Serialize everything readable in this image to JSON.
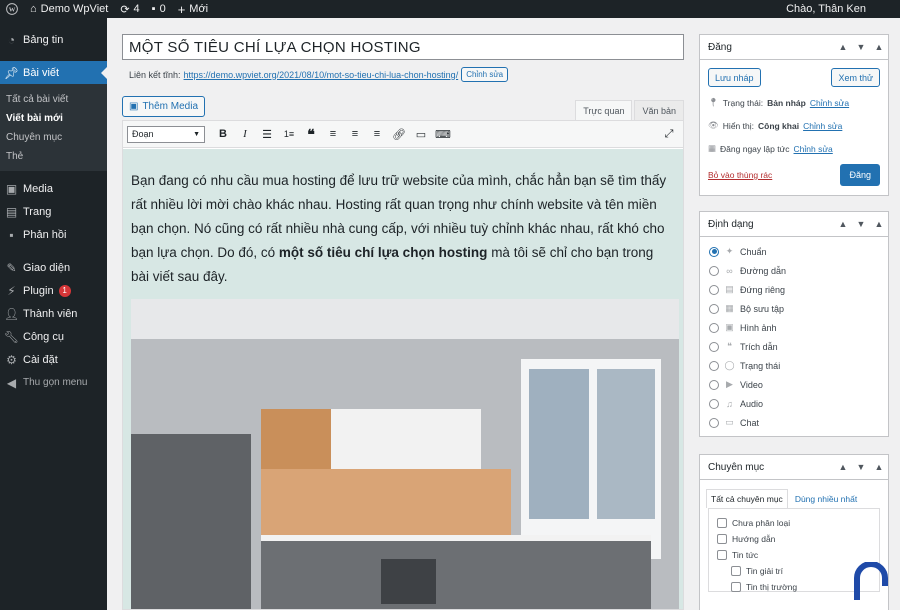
{
  "adminbar": {
    "site_name": "Demo WpViet",
    "updates_count": "4",
    "comments_count": "0",
    "new_label": "Mới",
    "greeting": "Chào, Thân Ken"
  },
  "sidebar": {
    "dashboard": "Bảng tin",
    "posts": "Bài viết",
    "posts_sub": [
      "Tất cả bài viết",
      "Viết bài mới",
      "Chuyên mục",
      "Thẻ"
    ],
    "media": "Media",
    "pages": "Trang",
    "comments": "Phản hồi",
    "appearance": "Giao diện",
    "plugins": "Plugin",
    "plugins_badge": "1",
    "users": "Thành viên",
    "tools": "Công cụ",
    "settings": "Cài đặt",
    "collapse": "Thu gọn menu"
  },
  "editor": {
    "title_value": "MỘT SỐ TIÊU CHÍ LỰA CHỌN HOSTING",
    "permalink_label": "Liên kết tĩnh:",
    "permalink_url": "https://demo.wpviet.org/2021/08/10/mot-so-tieu-chi-lua-chon-hosting/",
    "permalink_edit": "Chỉnh sửa",
    "add_media": "Thêm Media",
    "tab_visual": "Trực quan",
    "tab_text": "Văn bản",
    "format_select": "Đoạn",
    "paragraph_before": "Bạn đang có nhu cầu mua hosting để lưu trữ website của mình, chắc hẳn bạn sẽ tìm thấy rất nhiều lời mời chào khác nhau. Hosting rất quan trọng như chính website và tên miền bạn chọn. Nó cũng có rất nhiều nhà cung cấp, với nhiều tuỳ chỉnh khác nhau, rất khó cho bạn lựa chọn. Do đó, có ",
    "paragraph_bold": "một số tiêu chí lựa chọn hosting",
    "paragraph_after": " mà tôi sẽ chỉ cho bạn trong bài viết sau đây."
  },
  "publish": {
    "title": "Đăng",
    "save_draft": "Lưu nháp",
    "preview": "Xem thử",
    "status_label": "Trạng thái:",
    "status_value": "Bản nháp",
    "visibility_label": "Hiển thị:",
    "visibility_value": "Công khai",
    "schedule_value": "Đăng ngay lập tức",
    "edit_link": "Chỉnh sửa",
    "trash": "Bỏ vào thùng rác",
    "publish_button": "Đăng"
  },
  "format": {
    "title": "Định dạng",
    "options": [
      "Chuẩn",
      "Đường dẫn",
      "Đứng riêng",
      "Bộ sưu tập",
      "Hình ảnh",
      "Trích dẫn",
      "Trạng thái",
      "Video",
      "Audio",
      "Chat"
    ],
    "selected": "Chuẩn"
  },
  "categories": {
    "title": "Chuyên mục",
    "tab_all": "Tất cả chuyên mục",
    "tab_popular": "Dùng nhiều nhất",
    "items": [
      "Chưa phân loại",
      "Hướng dẫn",
      "Tin tức"
    ],
    "children": [
      "Tin giải trí",
      "Tin thị trường"
    ]
  },
  "colors": {
    "accent": "#2271b1",
    "adminbar": "#1d2327",
    "editor_bg": "#d7e7e4"
  }
}
